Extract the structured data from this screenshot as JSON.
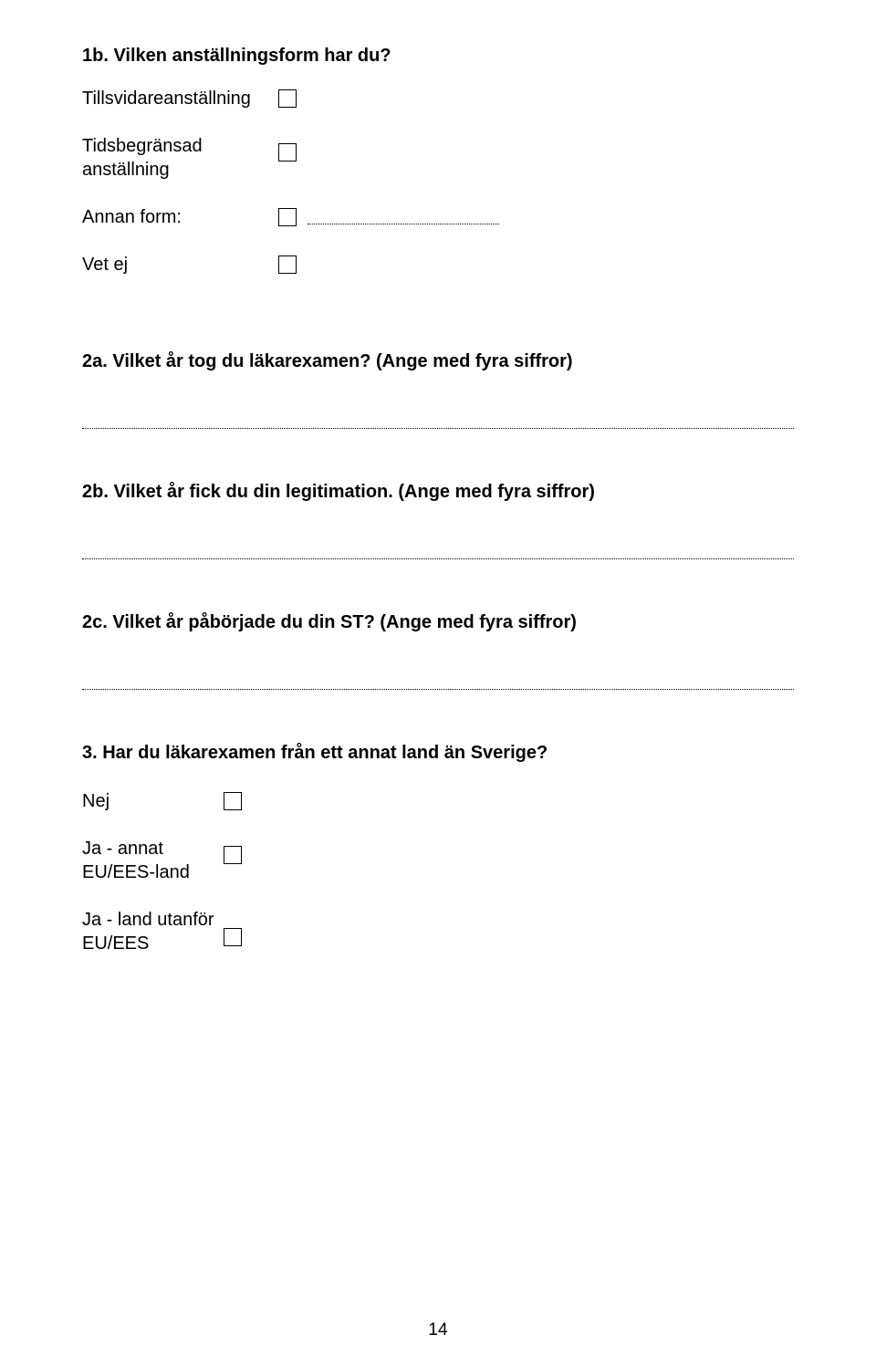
{
  "q1b": {
    "title": "1b. Vilken anställningsform har du?",
    "options": {
      "tillsvidare": "Tillsvidareanställning",
      "tidsbegransad": "Tidsbegränsad anställning",
      "annan": "Annan form:",
      "vetej": "Vet ej"
    }
  },
  "q2a": {
    "title": "2a. Vilket år tog du läkarexamen? (Ange med fyra siffror)"
  },
  "q2b": {
    "title": "2b. Vilket år fick du din legitimation. (Ange med fyra siffror)"
  },
  "q2c": {
    "title": "2c. Vilket år påbörjade du din ST? (Ange med fyra siffror)"
  },
  "q3": {
    "title": "3. Har du läkarexamen från ett annat land än Sverige?",
    "options": {
      "nej": "Nej",
      "eu": "Ja - annat EU/EES-land",
      "utanfor": "Ja - land utanför EU/EES"
    }
  },
  "page_number": "14"
}
